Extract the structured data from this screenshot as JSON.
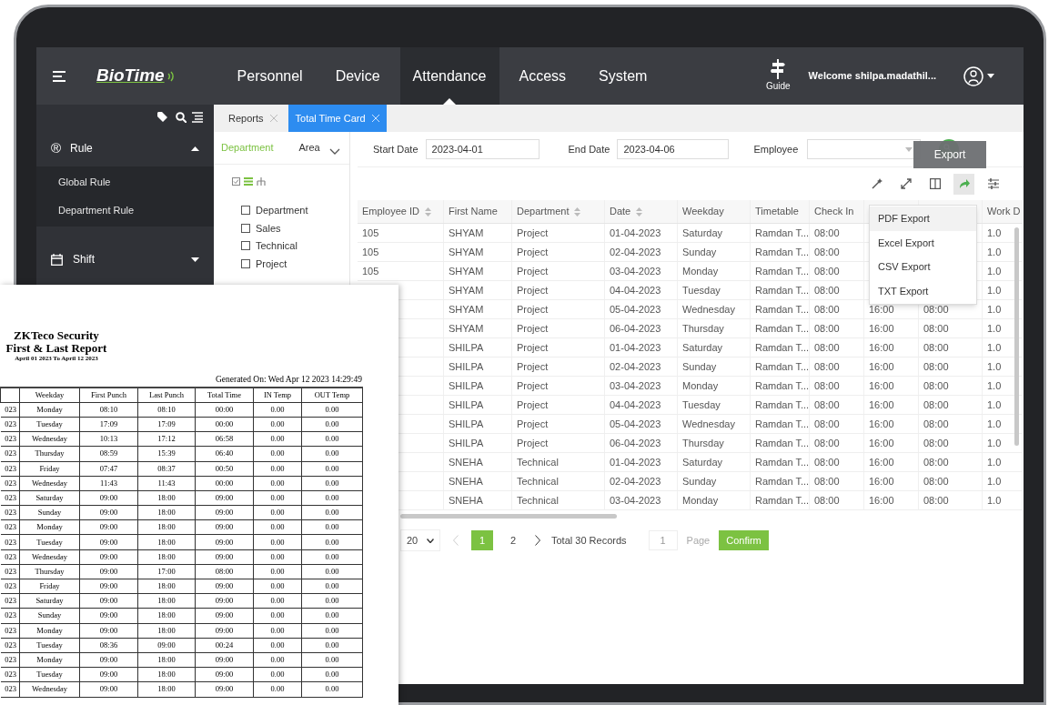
{
  "nav": {
    "logo": "BioTime",
    "items": [
      {
        "label": "Personnel",
        "selected": false
      },
      {
        "label": "Device",
        "selected": false
      },
      {
        "label": "Attendance",
        "selected": true
      },
      {
        "label": "Access",
        "selected": false
      },
      {
        "label": "System",
        "selected": false
      }
    ],
    "guide": "Guide",
    "welcome": "Welcome shilpa.madathil..."
  },
  "sidebar": {
    "items": [
      {
        "label": "Rule",
        "icon": "®",
        "expanded": true,
        "children": [
          {
            "label": "Global Rule"
          },
          {
            "label": "Department Rule"
          }
        ]
      },
      {
        "label": "Shift",
        "expanded": false
      }
    ]
  },
  "tabs": [
    {
      "label": "Reports",
      "selected": false
    },
    {
      "label": "Total Time Card",
      "selected": true
    }
  ],
  "left_panel": {
    "tabs": [
      {
        "label": "Department",
        "selected": true
      },
      {
        "label": "Area",
        "selected": false
      }
    ],
    "tree": [
      {
        "label": "Department",
        "checked": false
      },
      {
        "label": "Sales",
        "checked": false
      },
      {
        "label": "Technical",
        "checked": false
      },
      {
        "label": "Project",
        "checked": false
      }
    ]
  },
  "filters": {
    "start_date": {
      "label": "Start Date",
      "value": "2023-04-01"
    },
    "end_date": {
      "label": "End Date",
      "value": "2023-04-06"
    },
    "employee": {
      "label": "Employee"
    }
  },
  "tooltip": "Export",
  "export_menu": [
    {
      "label": "PDF Export",
      "selected": true
    },
    {
      "label": "Excel Export",
      "selected": false
    },
    {
      "label": "CSV Export",
      "selected": false
    },
    {
      "label": "TXT Export",
      "selected": false
    }
  ],
  "table": {
    "columns": [
      {
        "label": "Employee ID",
        "sortable": true
      },
      {
        "label": "First Name",
        "sortable": false
      },
      {
        "label": "Department",
        "sortable": true
      },
      {
        "label": "Date",
        "sortable": true
      },
      {
        "label": "Weekday",
        "sortable": false
      },
      {
        "label": "Timetable",
        "sortable": false
      },
      {
        "label": "Check In",
        "sortable": false
      },
      null,
      null,
      {
        "label": "Work D"
      }
    ],
    "rows": [
      [
        "105",
        "SHYAM",
        "Project",
        "01-04-2023",
        "Saturday",
        "Ramdan T...",
        "08:00",
        null,
        null,
        "1.0"
      ],
      [
        "105",
        "SHYAM",
        "Project",
        "02-04-2023",
        "Sunday",
        "Ramdan T...",
        "08:00",
        null,
        null,
        "1.0"
      ],
      [
        "105",
        "SHYAM",
        "Project",
        "03-04-2023",
        "Monday",
        "Ramdan T...",
        "08:00",
        null,
        null,
        "1.0"
      ],
      [
        null,
        "SHYAM",
        "Project",
        "04-04-2023",
        "Tuesday",
        "Ramdan T...",
        "08:00",
        null,
        null,
        "1.0"
      ],
      [
        null,
        "SHYAM",
        "Project",
        "05-04-2023",
        "Wednesday",
        "Ramdan T...",
        "08:00",
        "16:00",
        "08:00",
        "1.0"
      ],
      [
        null,
        "SHYAM",
        "Project",
        "06-04-2023",
        "Thursday",
        "Ramdan T...",
        "08:00",
        "16:00",
        "08:00",
        "1.0"
      ],
      [
        null,
        "SHILPA",
        "Project",
        "01-04-2023",
        "Saturday",
        "Ramdan T...",
        "08:00",
        "16:00",
        "08:00",
        "1.0"
      ],
      [
        null,
        "SHILPA",
        "Project",
        "02-04-2023",
        "Sunday",
        "Ramdan T...",
        "08:00",
        "16:00",
        "08:00",
        "1.0"
      ],
      [
        null,
        "SHILPA",
        "Project",
        "03-04-2023",
        "Monday",
        "Ramdan T...",
        "08:00",
        "16:00",
        "08:00",
        "1.0"
      ],
      [
        null,
        "SHILPA",
        "Project",
        "04-04-2023",
        "Tuesday",
        "Ramdan T...",
        "08:00",
        "16:00",
        "08:00",
        "1.0"
      ],
      [
        null,
        "SHILPA",
        "Project",
        "05-04-2023",
        "Wednesday",
        "Ramdan T...",
        "08:00",
        "16:00",
        "08:00",
        "1.0"
      ],
      [
        null,
        "SHILPA",
        "Project",
        "06-04-2023",
        "Thursday",
        "Ramdan T...",
        "08:00",
        "16:00",
        "08:00",
        "1.0"
      ],
      [
        null,
        "SNEHA",
        "Technical",
        "01-04-2023",
        "Saturday",
        "Ramdan T...",
        "08:00",
        "16:00",
        "08:00",
        "1.0"
      ],
      [
        null,
        "SNEHA",
        "Technical",
        "02-04-2023",
        "Sunday",
        "Ramdan T...",
        "08:00",
        "16:00",
        "08:00",
        "1.0"
      ],
      [
        null,
        "SNEHA",
        "Technical",
        "03-04-2023",
        "Monday",
        "Ramdan T...",
        "08:00",
        "16:00",
        "08:00",
        "1.0"
      ]
    ]
  },
  "pagination": {
    "page_size": "20",
    "pages": [
      {
        "label": "1",
        "selected": true
      },
      {
        "label": "2",
        "selected": false
      }
    ],
    "total": "Total 30 Records",
    "page_input": "1",
    "page_label": "Page",
    "confirm": "Confirm"
  },
  "report": {
    "company": "ZKTeco Security",
    "title": "First & Last Report",
    "range": "April 01 2023 To April 12 2023",
    "generated": "Generated On: Wed Apr 12 2023 14:29:49",
    "columns": [
      null,
      "Weekday",
      "First Punch",
      "Last Punch",
      "Total Time",
      "IN Temp",
      "OUT Temp"
    ],
    "rows": [
      [
        "023",
        "Monday",
        "08:10",
        "08:10",
        "00:00",
        "0.00",
        "0.00"
      ],
      [
        "023",
        "Tuesday",
        "17:09",
        "17:09",
        "00:00",
        "0.00",
        "0.00"
      ],
      [
        "023",
        "Wednesday",
        "10:13",
        "17:12",
        "06:58",
        "0.00",
        "0.00"
      ],
      [
        "023",
        "Thursday",
        "08:59",
        "15:39",
        "06:40",
        "0.00",
        "0.00"
      ],
      [
        "023",
        "Friday",
        "07:47",
        "08:37",
        "00:50",
        "0.00",
        "0.00"
      ],
      [
        "023",
        "Wednesday",
        "11:43",
        "11:43",
        "00:00",
        "0.00",
        "0.00"
      ],
      [
        "023",
        "Saturday",
        "09:00",
        "18:00",
        "09:00",
        "0.00",
        "0.00"
      ],
      [
        "023",
        "Sunday",
        "09:00",
        "18:00",
        "09:00",
        "0.00",
        "0.00"
      ],
      [
        "023",
        "Monday",
        "09:00",
        "18:00",
        "09:00",
        "0.00",
        "0.00"
      ],
      [
        "023",
        "Tuesday",
        "09:00",
        "18:00",
        "09:00",
        "0.00",
        "0.00"
      ],
      [
        "023",
        "Wednesday",
        "09:00",
        "18:00",
        "09:00",
        "0.00",
        "0.00"
      ],
      [
        "023",
        "Thursday",
        "09:00",
        "17:00",
        "08:00",
        "0.00",
        "0.00"
      ],
      [
        "023",
        "Friday",
        "09:00",
        "18:00",
        "09:00",
        "0.00",
        "0.00"
      ],
      [
        "023",
        "Saturday",
        "09:00",
        "18:00",
        "09:00",
        "0.00",
        "0.00"
      ],
      [
        "023",
        "Sunday",
        "09:00",
        "18:00",
        "09:00",
        "0.00",
        "0.00"
      ],
      [
        "023",
        "Monday",
        "09:00",
        "18:00",
        "09:00",
        "0.00",
        "0.00"
      ],
      [
        "023",
        "Tuesday",
        "08:36",
        "09:00",
        "00:24",
        "0.00",
        "0.00"
      ],
      [
        "023",
        "Monday",
        "09:00",
        "18:00",
        "09:00",
        "0.00",
        "0.00"
      ],
      [
        "023",
        "Tuesday",
        "09:00",
        "18:00",
        "09:00",
        "0.00",
        "0.00"
      ],
      [
        "023",
        "Wednesday",
        "09:00",
        "18:00",
        "09:00",
        "0.00",
        "0.00"
      ]
    ]
  }
}
